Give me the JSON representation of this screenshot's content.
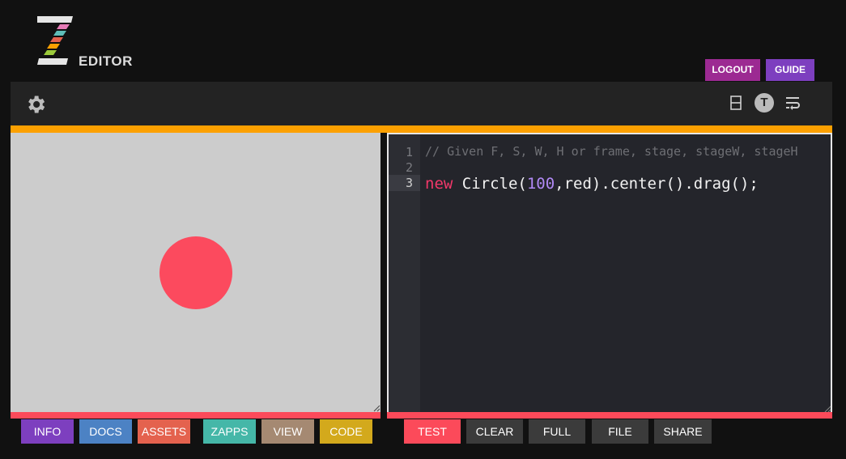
{
  "logo": {
    "word": "EDITOR",
    "letter": "Z"
  },
  "header": {
    "logout_label": "LOGOUT",
    "guide_label": "GUIDE"
  },
  "toolbar": {
    "theme_letter": "T"
  },
  "editor": {
    "line_numbers": [
      "1",
      "2",
      "3"
    ],
    "line1": "// Given F, S, W, H or frame, stage, stageW, stageH",
    "line3": {
      "kw": "new",
      "pre": " Circle(",
      "num": "100",
      "post": ",red).center().drag();"
    }
  },
  "stage": {
    "shape": "circle",
    "color": "#fc4a5e"
  },
  "bottom_left": {
    "info": "INFO",
    "docs": "DOCS",
    "assets": "ASSETS",
    "zapps": "ZAPPS",
    "view": "VIEW",
    "code": "CODE"
  },
  "bottom_right": {
    "test": "TEST",
    "clear": "CLEAR",
    "full": "FULL",
    "file": "FILE",
    "share": "SHARE"
  },
  "colors": {
    "accent_orange": "#fca000",
    "accent_red": "#fc4a5a",
    "purple": "#7d3fbf",
    "magenta": "#9c2a92"
  }
}
